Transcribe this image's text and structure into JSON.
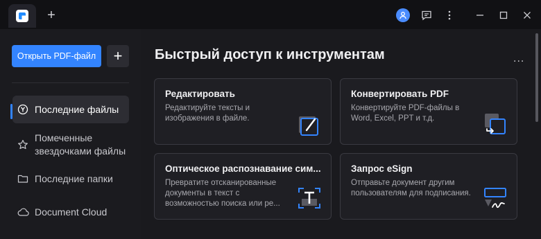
{
  "titlebar": {
    "new_tab": "+",
    "icons": [
      "user-avatar-icon",
      "feedback-icon",
      "more-vertical-icon",
      "minimize-icon",
      "maximize-icon",
      "close-icon"
    ]
  },
  "sidebar": {
    "open_button": "Открыть PDF-файл",
    "add_button": "+",
    "items": [
      {
        "label": "Последние файлы",
        "icon": "recent-icon",
        "active": true
      },
      {
        "label": "Помеченные звездочками файлы",
        "icon": "star-icon",
        "active": false
      },
      {
        "label": "Последние папки",
        "icon": "folder-icon",
        "active": false
      },
      {
        "label": "Document Cloud",
        "icon": "cloud-icon",
        "active": false
      }
    ]
  },
  "main": {
    "heading": "Быстрый доступ к инструментам",
    "more": "...",
    "cards": [
      {
        "title": "Редактировать",
        "desc": "Редактируйте тексты и изображения в файле.",
        "icon": "edit-icon"
      },
      {
        "title": "Конвертировать PDF",
        "desc": "Конвертируйте PDF-файлы в Word, Excel, PPT и т.д.",
        "icon": "convert-icon"
      },
      {
        "title": "Оптическое распознавание сим...",
        "desc": "Превратите отсканированные документы в текст с возможностью поиска или ре...",
        "icon": "ocr-icon"
      },
      {
        "title": "Запрос eSign",
        "desc": "Отправьте документ другим пользователям для подписания.",
        "icon": "esign-icon"
      }
    ]
  },
  "colors": {
    "accent": "#3384ff",
    "background": "#1a1a1e",
    "sidebar": "#1b1b1f"
  }
}
